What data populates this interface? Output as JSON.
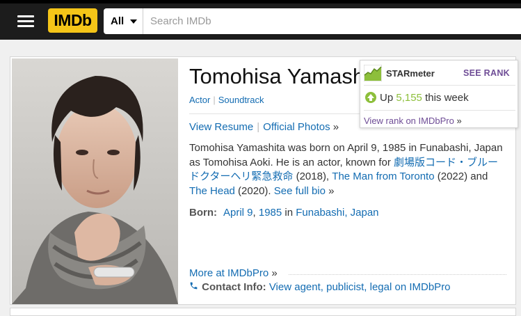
{
  "header": {
    "logo_text": "IMDb",
    "search_category": "All",
    "search_placeholder": "Search IMDb",
    "search_value": ""
  },
  "person": {
    "name": "Tomohisa Yamashita",
    "jobs": [
      "Actor",
      "Soundtrack"
    ],
    "view_resume": "View Resume",
    "official_photos": "Official Photos",
    "bio_intro": "Tomohisa Yamashita was born on April 9, 1985 in Funabashi, Japan as Tomohisa Aoki. He is an actor, known for ",
    "bio_title1": "劇場版コード・ブルー　ドクターヘリ緊急救命",
    "bio_year1": " (2018), ",
    "bio_title2": "The Man from Toronto",
    "bio_year2": " (2022) and ",
    "bio_title3": "The Head",
    "bio_year3": " (2020). ",
    "see_full_bio": "See full bio",
    "born_label": "Born:",
    "born_date": "April 9",
    "born_year": "1985",
    "born_in": " in ",
    "born_place": "Funabashi, Japan",
    "more_at": "More at IMDbPro",
    "contact_label": "Contact Info:",
    "contact_link": "View agent, publicist, legal on IMDbPro",
    "raquo": "»",
    "separator": "|"
  },
  "starmeter": {
    "title": "STARmeter",
    "see_rank": "SEE RANK",
    "up_label": "Up",
    "up_value": "5,155",
    "up_suffix": "this week",
    "view_rank": "View rank on IMDbPro"
  },
  "colors": {
    "imdb_yellow": "#f5c518",
    "link_blue": "#136cb2",
    "pro_purple": "#6f4d96",
    "rank_green": "#8dbf3b"
  }
}
